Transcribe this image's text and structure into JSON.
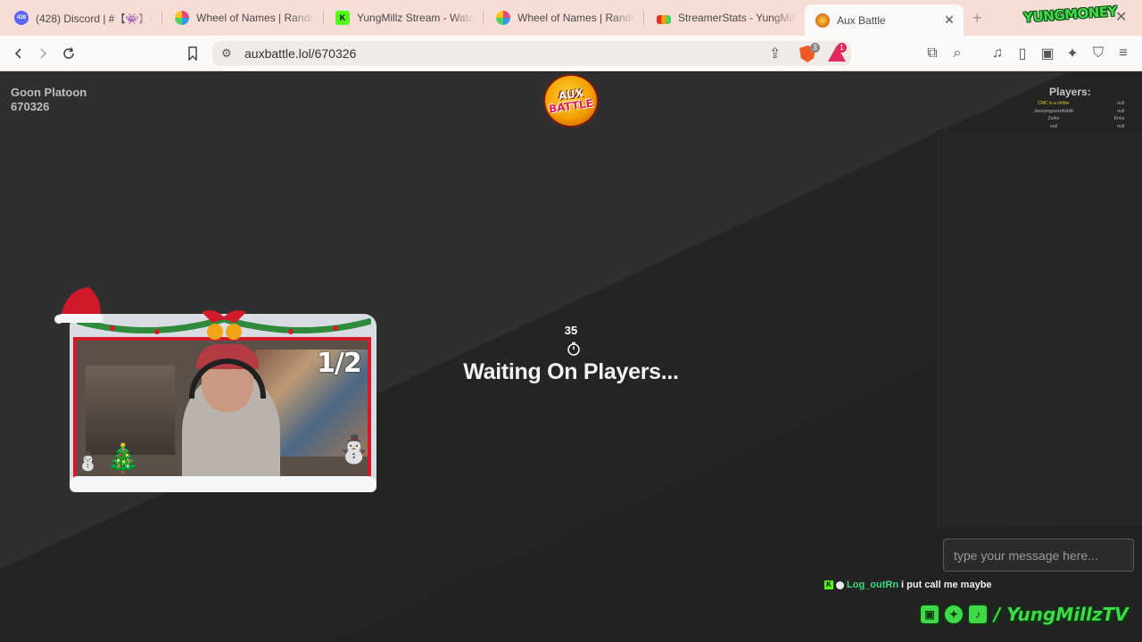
{
  "browser": {
    "tabs": [
      {
        "title": "(428) Discord | #【👾】Gene",
        "favicon": "discord-icon",
        "color": "#5865f2",
        "badge": "428"
      },
      {
        "title": "Wheel of Names | Random",
        "favicon": "wheel-icon",
        "color": "#e64980"
      },
      {
        "title": "YungMillz Stream - Watch",
        "favicon": "kick-icon",
        "color": "#53fc18"
      },
      {
        "title": "Wheel of Names | Random",
        "favicon": "wheel-icon",
        "color": "#e64980"
      },
      {
        "title": "StreamerStats - YungMillz",
        "favicon": "stats-icon",
        "color": "#f59f00"
      },
      {
        "title": "Aux Battle",
        "favicon": "aux-battle-icon",
        "color": "#f59f00",
        "active": true
      }
    ],
    "url": "auxbattle.lol/670326",
    "brave_badge": "3",
    "rewards_badge": "1"
  },
  "overlay_logo": "YUNGMONEY",
  "room": {
    "name": "Goon Platoon",
    "code": "670326"
  },
  "logo": {
    "line1": "AUX",
    "line2": "BATTLE"
  },
  "players": {
    "title": "Players:",
    "list": [
      {
        "name": "CMC is a shitter",
        "score": "null",
        "highlight": true
      },
      {
        "name": "Jeezyingoonshlxbt8",
        "score": "null"
      },
      {
        "name": "Zurks",
        "score": "Erica"
      },
      {
        "name": "null",
        "score": "null"
      }
    ]
  },
  "timer": {
    "seconds": "35"
  },
  "status": "Waiting On Players...",
  "chat": {
    "placeholder": "type your message here..."
  },
  "stream": {
    "counter": "1/2",
    "chat_message": {
      "user": "Log_outRn",
      "text": "i put call me maybe"
    },
    "social_handle": "/ YungMillzTV"
  }
}
